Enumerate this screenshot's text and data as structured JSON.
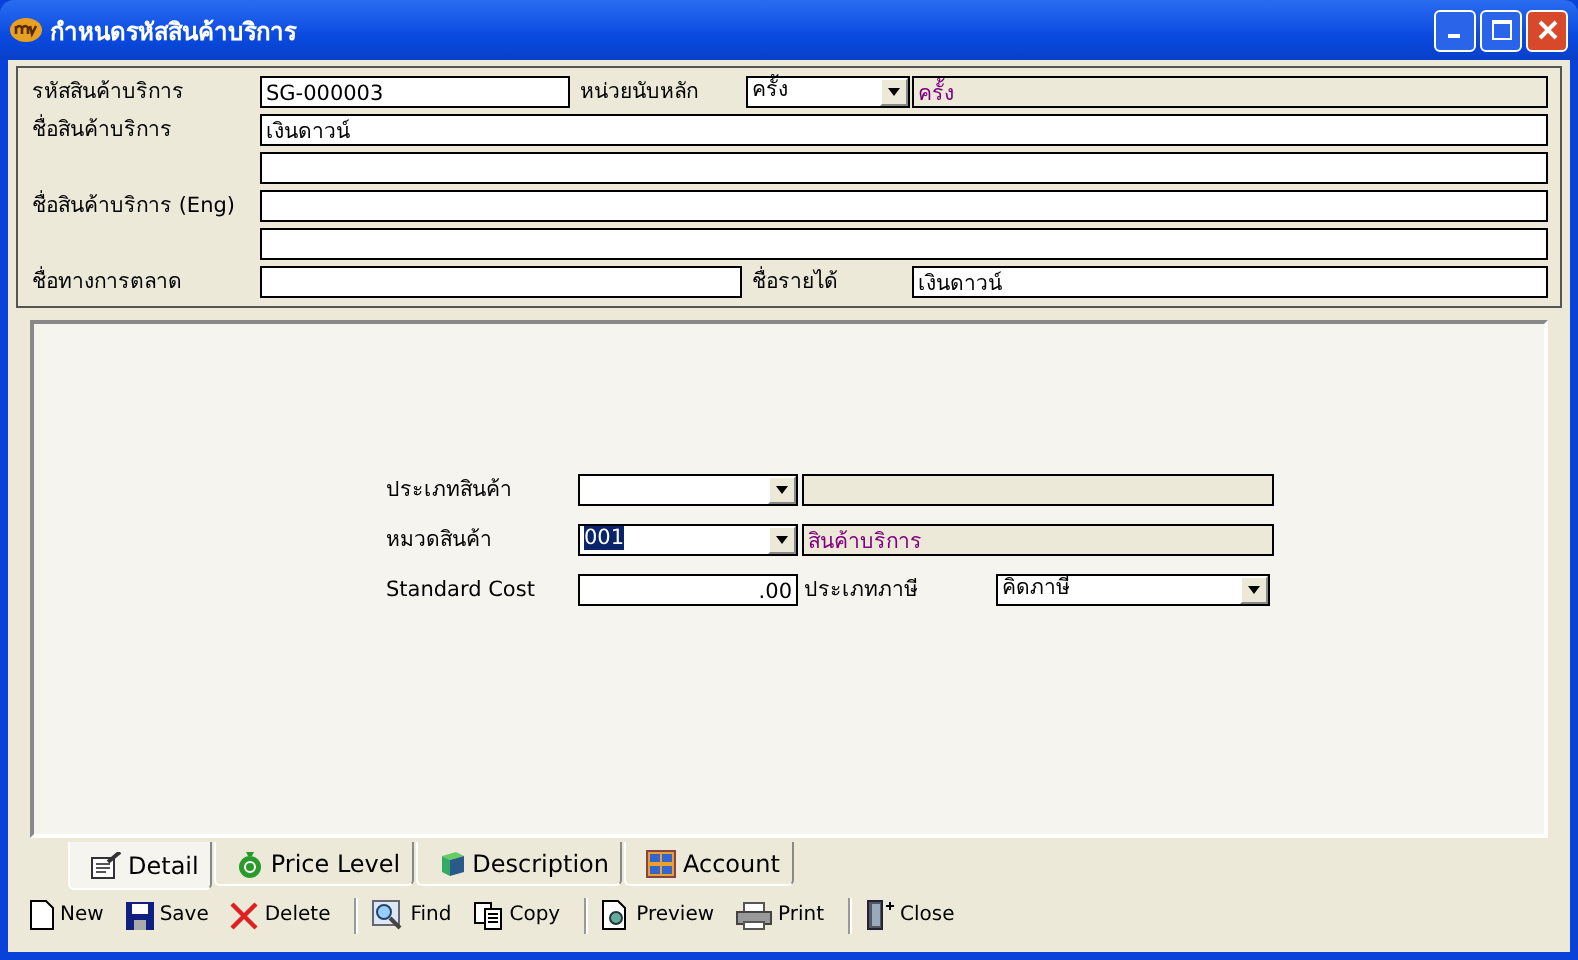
{
  "window": {
    "title": "กำหนดรหัสสินค้าบริการ"
  },
  "header": {
    "code": {
      "label": "รหัสสินค้าบริการ",
      "value": "SG-000003"
    },
    "unit": {
      "label": "หน่วยนับหลัก",
      "value": "ครั้ง",
      "display": "ครั้ง"
    },
    "name": {
      "label": "ชื่อสินค้าบริการ",
      "value": "เงินดาวน์"
    },
    "name_eng": {
      "label": "ชื่อสินค้าบริการ (Eng)"
    },
    "marketing_name": {
      "label": "ชื่อทางการตลาด"
    },
    "revenue_name": {
      "label": "ชื่อรายได้",
      "value": "เงินดาวน์"
    }
  },
  "detail": {
    "product_type": {
      "label": "ประเภทสินค้า"
    },
    "category": {
      "label": "หมวดสินค้า",
      "value": "001",
      "value_selected": true,
      "display": "สินค้าบริการ"
    },
    "standard_cost": {
      "label": "Standard Cost",
      "value": ".00"
    },
    "tax_type": {
      "label": "ประเภทภาษี",
      "value": "คิดภาษี"
    }
  },
  "tabs": [
    {
      "label": "Detail",
      "kind": "detail",
      "selected": true
    },
    {
      "label": "Price Level",
      "kind": "money",
      "selected": false
    },
    {
      "label": "Description",
      "kind": "book",
      "selected": false
    },
    {
      "label": "Account",
      "kind": "grid",
      "selected": false
    }
  ],
  "toolbar": [
    {
      "label": "New",
      "kind": "new"
    },
    {
      "label": "Save",
      "kind": "save"
    },
    {
      "label": "Delete",
      "kind": "delete"
    },
    {
      "label": "Find",
      "kind": "find"
    },
    {
      "label": "Copy",
      "kind": "copy"
    },
    {
      "label": "Preview",
      "kind": "preview"
    },
    {
      "label": "Print",
      "kind": "print"
    },
    {
      "label": "Close",
      "kind": "close"
    }
  ]
}
